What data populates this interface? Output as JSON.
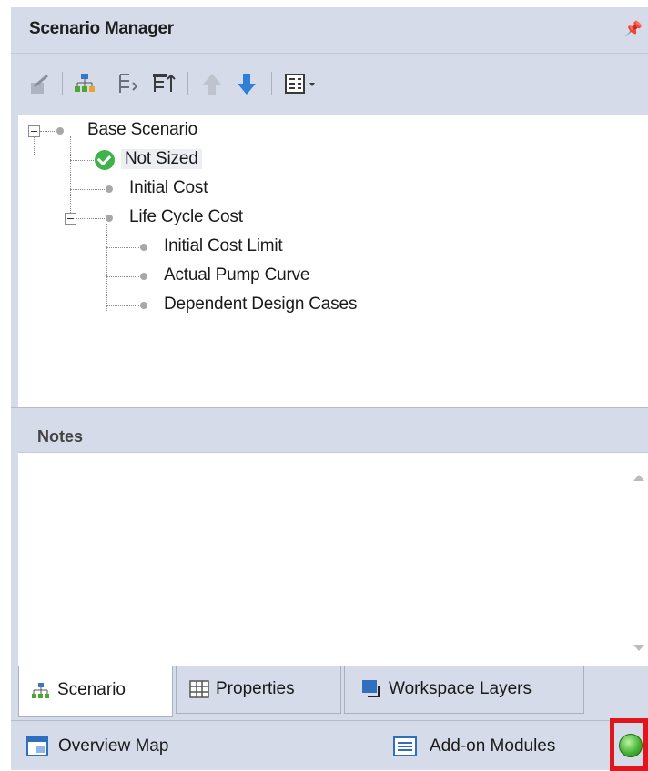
{
  "panel": {
    "title": "Scenario Manager"
  },
  "tree": [
    {
      "label": "Base Scenario"
    },
    {
      "label": "Not Sized"
    },
    {
      "label": "Initial Cost"
    },
    {
      "label": "Life Cycle Cost"
    },
    {
      "label": "Initial Cost Limit"
    },
    {
      "label": "Actual Pump Curve"
    },
    {
      "label": "Dependent Design Cases"
    }
  ],
  "notes": {
    "title": "Notes",
    "text": ""
  },
  "tabs": [
    {
      "label": "Scenario"
    },
    {
      "label": "Properties"
    },
    {
      "label": "Workspace Layers"
    }
  ],
  "status": {
    "overview_label": "Overview Map",
    "addon_label": "Add-on Modules"
  },
  "colors": {
    "panel_bg": "#d6dbe9",
    "check_green": "#3fb24a",
    "highlight_red": "#e0161c",
    "arrow_blue": "#2f7fd6"
  }
}
